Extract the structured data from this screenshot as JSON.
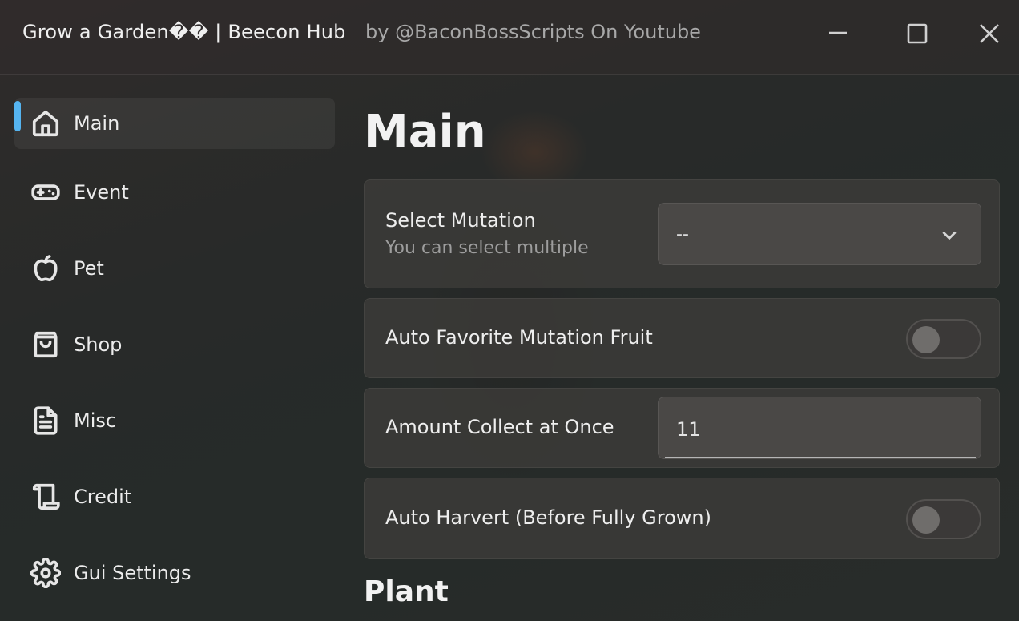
{
  "window": {
    "title": "Grow a Garden�� | Beecon Hub",
    "subtitle": "by @BaconBossScripts On Youtube",
    "controls": [
      "minimize-icon",
      "maximize-icon",
      "close-icon"
    ]
  },
  "sidebar": {
    "accent_color": "#55b4f0",
    "active_index": 0,
    "items": [
      {
        "label": "Main",
        "icon": "home-icon"
      },
      {
        "label": "Event",
        "icon": "gamepad-icon"
      },
      {
        "label": "Pet",
        "icon": "apple-icon"
      },
      {
        "label": "Shop",
        "icon": "shopping-bag-icon"
      },
      {
        "label": "Misc",
        "icon": "document-icon"
      },
      {
        "label": "Credit",
        "icon": "scroll-icon"
      },
      {
        "label": "Gui Settings",
        "icon": "gear-icon"
      }
    ]
  },
  "main": {
    "title": "Main",
    "select_mutation": {
      "title": "Select Mutation",
      "description": "You can select multiple",
      "value": "--"
    },
    "auto_favorite": {
      "title": "Auto Favorite Mutation Fruit",
      "enabled": false
    },
    "amount_collect": {
      "title": "Amount Collect at Once",
      "value": "11"
    },
    "auto_harvest": {
      "title": "Auto Harvert (Before Fully Grown)",
      "enabled": false
    },
    "next_section": "Plant"
  }
}
